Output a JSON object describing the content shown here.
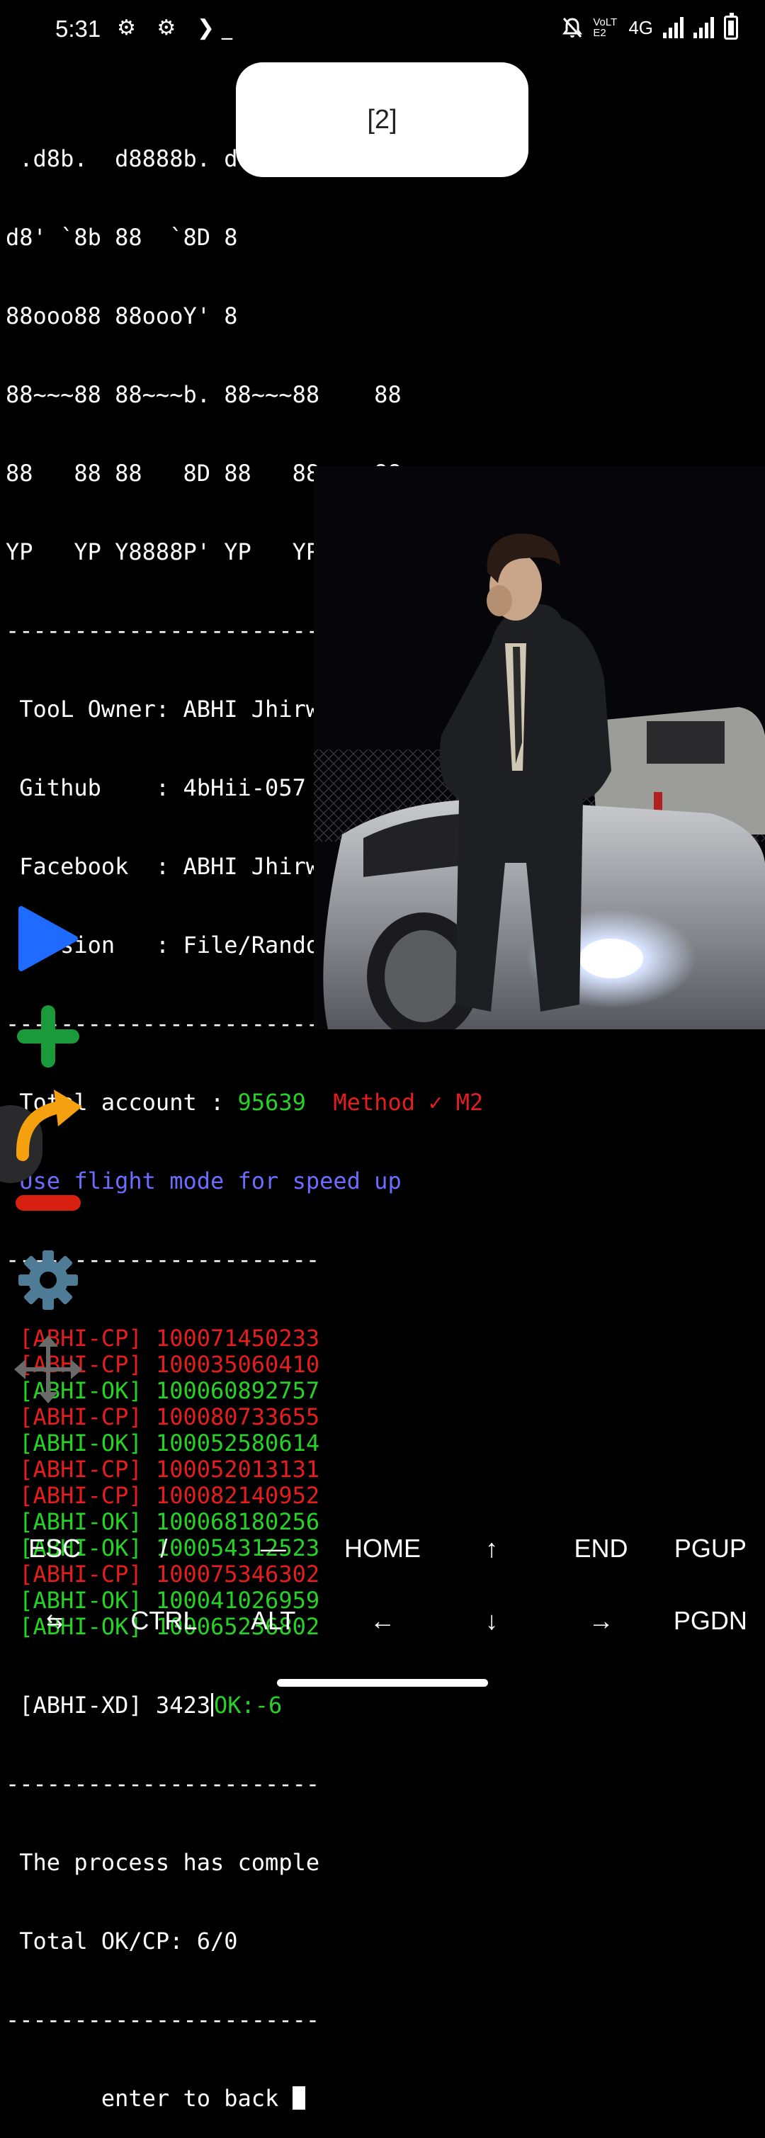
{
  "status_bar": {
    "time": "5:31",
    "left_icons": "⚙ ⚙ ❯_",
    "network_label": "4G",
    "volte_label": "VoLTE2"
  },
  "toast": {
    "text": "[2]"
  },
  "terminal": {
    "banner": [
      " .d8b.  d8888b. d",
      "d8' `8b 88  `8D 8",
      "88ooo88 88oooY' 8",
      "88~~~88 88~~~b. 88~~~88    88",
      "88   88 88   8D 88   88   .88.",
      "YP   YP Y8888P' YP   YP Y888888P"
    ],
    "separator_long": "-----------------------------------------------",
    "separator_short": "-----------------------",
    "info": {
      "owner_label": " TooL Owner: ",
      "owner_value": "ABHI Jhirwal",
      "github_label": " Github    : ",
      "github_value": "4bHii-057",
      "facebook_label": " Facebook  : ",
      "facebook_value": "ABHI Jhirwal",
      "version_label": " Version   : ",
      "version_value": "File/Random/0.7/Free ",
      "version_check": "(✓)"
    },
    "total_label": " Total account : ",
    "total_value": "95639",
    "method_label": "  Method ✓ M2",
    "flight_tip": " Use flight mode for speed up",
    "results": [
      {
        "tag": " [ABHI-CP] ",
        "id": "100071450233",
        "status": "cp"
      },
      {
        "tag": " [ABHI-CP] ",
        "id": "100035060410",
        "status": "cp"
      },
      {
        "tag": " [ABHI-OK] ",
        "id": "100060892757",
        "status": "ok"
      },
      {
        "tag": " [ABHI-CP] ",
        "id": "100080733655",
        "status": "cp"
      },
      {
        "tag": " [ABHI-OK] ",
        "id": "100052580614",
        "status": "ok"
      },
      {
        "tag": " [ABHI-CP] ",
        "id": "100052013131",
        "status": "cp"
      },
      {
        "tag": " [ABHI-CP] ",
        "id": "100082140952",
        "status": "cp"
      },
      {
        "tag": " [ABHI-OK] ",
        "id": "100068180256",
        "status": "ok"
      },
      {
        "tag": " [ABHI-OK] ",
        "id": "100054312523",
        "status": "ok"
      },
      {
        "tag": " [ABHI-CP] ",
        "id": "100075346302",
        "status": "cp"
      },
      {
        "tag": " [ABHI-OK] ",
        "id": "100041026959",
        "status": "ok"
      },
      {
        "tag": " [ABHI-OK] ",
        "id": "100065236802",
        "status": "ok"
      }
    ],
    "progress_prefix": " [ABHI-XD] 3423",
    "progress_ok": "OK:-6",
    "process_done": " The process has comple",
    "total_okcp": " Total OK/CP: 6/0",
    "separator_tail": "-----------------------",
    "press_enter": "       enter to back "
  },
  "sidebar": {
    "buttons": [
      "play-icon",
      "plus-icon",
      "redo-arrow-icon",
      "minus-icon",
      "gear-icon",
      "move-icon"
    ]
  },
  "extra_keys": {
    "row1": [
      "ESC",
      "/",
      "—",
      "HOME",
      "↑",
      "END",
      "PGUP"
    ],
    "row2": [
      "⇆",
      "CTRL",
      "ALT",
      "←",
      "↓",
      "→",
      "PGDN"
    ]
  },
  "colors": {
    "ok_green": "#27d227",
    "cp_red": "#e51d1d",
    "tip_blue": "#6c6cff",
    "play_blue": "#1f6bff",
    "plus_green": "#1a9a3a",
    "redo_orange": "#f5a00f",
    "minus_red": "#d82010",
    "gear_blue": "#4e7c96",
    "move_gray": "#6a6a6a"
  }
}
